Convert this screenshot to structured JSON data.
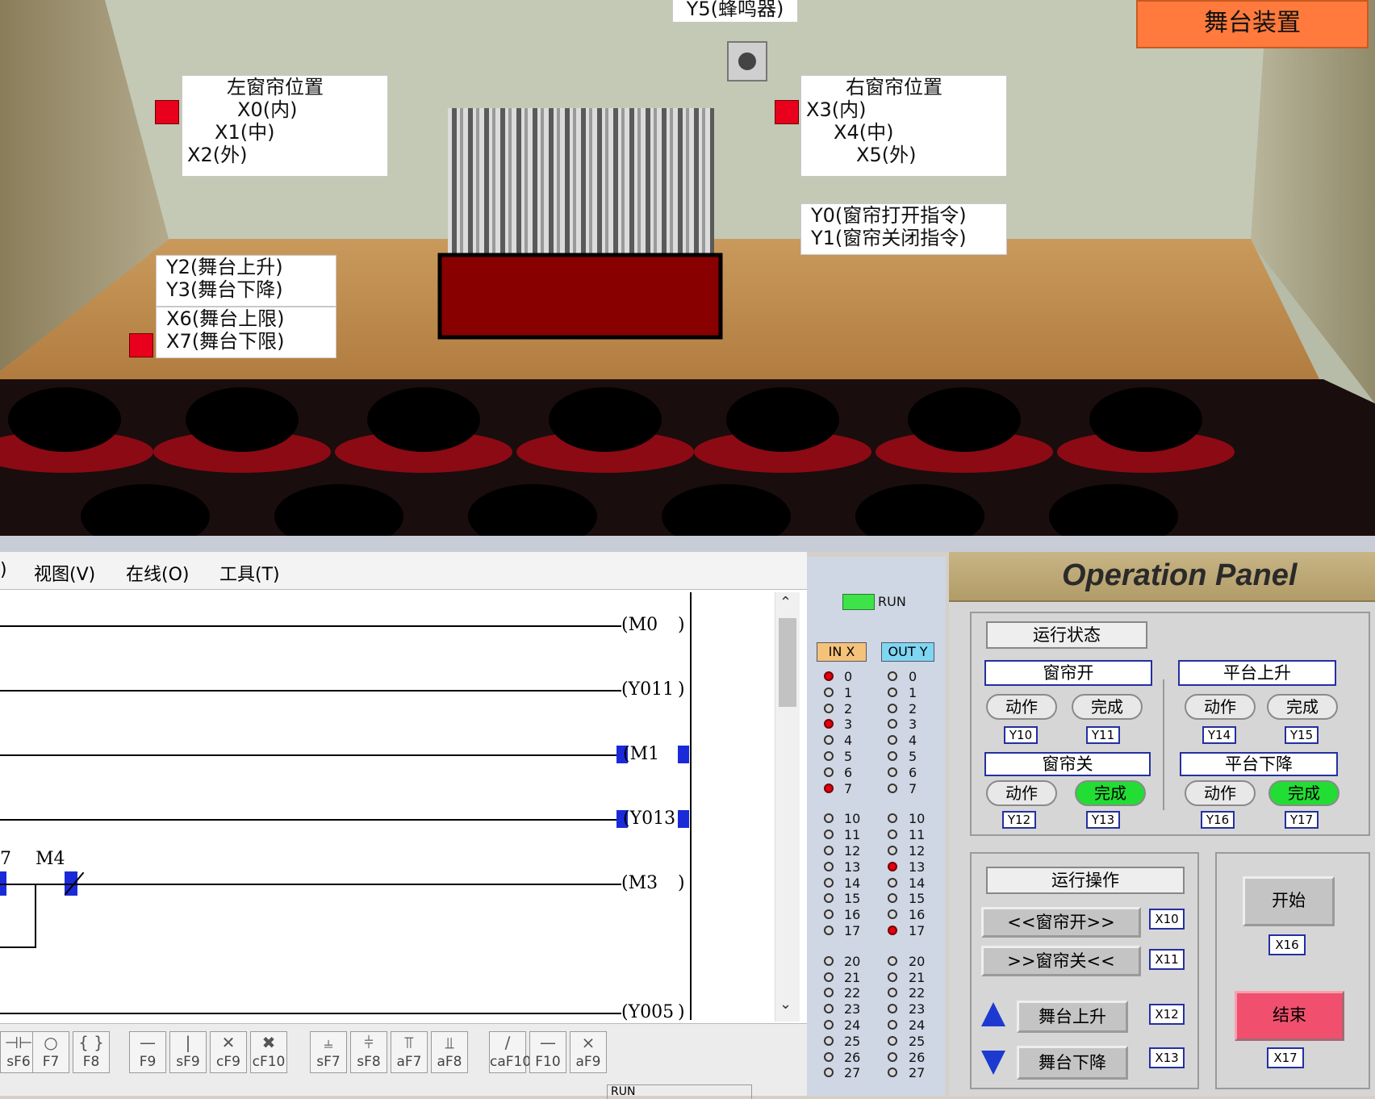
{
  "scene": {
    "title_button": "舞台装置",
    "buzzer_label": "Y5(蜂鸣器)",
    "left_curtain": {
      "title": "左窗帘位置",
      "lines": [
        "X0(内)",
        "X1(中)",
        "X2(外)"
      ]
    },
    "right_curtain": {
      "title": "右窗帘位置",
      "lines": [
        "X3(内)",
        "X4(中)",
        "X5(外)"
      ]
    },
    "curtain_cmds": [
      "Y0(窗帘打开指令)",
      "Y1(窗帘关闭指令)"
    ],
    "stage_cmds": [
      "Y2(舞台上升)",
      "Y3(舞台下降)"
    ],
    "stage_limits": [
      "X6(舞台上限)",
      "X7(舞台下限)"
    ]
  },
  "menubar": {
    "items": [
      "视图(V)",
      "在线(O)",
      "工具(T)"
    ],
    "partial": ")"
  },
  "ladder": {
    "coils": [
      "(M0",
      "(Y011",
      "(M1",
      "(Y013",
      "(M3",
      "(Y005"
    ],
    "contact_labels": [
      "7",
      "M4"
    ]
  },
  "fkeys": [
    {
      "glyph": "⊣⊢",
      "label": "sF6"
    },
    {
      "glyph": "○",
      "label": "F7"
    },
    {
      "glyph": "{ }",
      "label": "F8"
    },
    {
      "glyph": "—",
      "label": "F9"
    },
    {
      "glyph": "|",
      "label": "sF9"
    },
    {
      "glyph": "✕",
      "label": "cF9"
    },
    {
      "glyph": "✖",
      "label": "cF10"
    },
    {
      "glyph": "⫨",
      "label": "sF7"
    },
    {
      "glyph": "⫩",
      "label": "sF8"
    },
    {
      "glyph": "⫪",
      "label": "aF7"
    },
    {
      "glyph": "⫫",
      "label": "aF8"
    },
    {
      "glyph": "∕",
      "label": "caF10"
    },
    {
      "glyph": "—",
      "label": "F10"
    },
    {
      "glyph": "⨯",
      "label": "aF9"
    }
  ],
  "status_partial": "RUN",
  "io": {
    "run_label": "RUN",
    "in_header": "IN X",
    "out_header": "OUT Y",
    "rows": [
      "0",
      "1",
      "2",
      "3",
      "4",
      "5",
      "6",
      "7",
      "10",
      "11",
      "12",
      "13",
      "14",
      "15",
      "16",
      "17",
      "20",
      "21",
      "22",
      "23",
      "24",
      "25",
      "26",
      "27"
    ],
    "in_on": [
      "0",
      "3",
      "7"
    ],
    "out_on": [
      "13",
      "17"
    ]
  },
  "panel": {
    "title": "Operation Panel",
    "run_state": "运行状态",
    "curtain_open": "窗帘开",
    "curtain_close": "窗帘关",
    "platform_up": "平台上升",
    "platform_down": "平台下降",
    "action": "动作",
    "done": "完成",
    "tags": {
      "y10": "Y10",
      "y11": "Y11",
      "y12": "Y12",
      "y13": "Y13",
      "y14": "Y14",
      "y15": "Y15",
      "y16": "Y16",
      "y17": "Y17"
    },
    "run_ops": "运行操作",
    "btn_open": "<<窗帘开>>",
    "btn_close": ">>窗帘关<<",
    "btn_up": "舞台上升",
    "btn_down": "舞台下降",
    "btn_start": "开始",
    "btn_end": "结束",
    "xtags": {
      "x10": "X10",
      "x11": "X11",
      "x12": "X12",
      "x13": "X13",
      "x16": "X16",
      "x17": "X17"
    },
    "colors": {
      "end": "#f0506e",
      "done_on": "#22dd33",
      "accent": "#ff7a3c"
    }
  }
}
